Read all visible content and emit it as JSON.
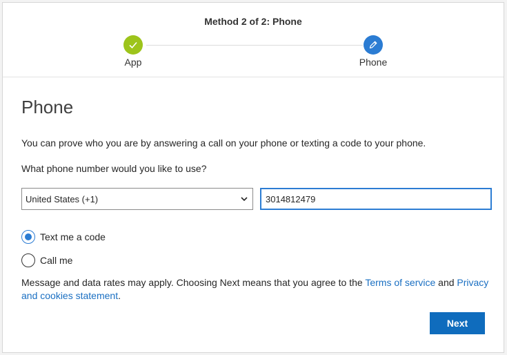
{
  "header": {
    "step_title": "Method 2 of 2: Phone",
    "steps": [
      {
        "label": "App",
        "state": "completed",
        "icon": "checkmark-icon",
        "color": "#9dc41b"
      },
      {
        "label": "Phone",
        "state": "current",
        "icon": "pencil-icon",
        "color": "#2b7cd3"
      }
    ]
  },
  "main": {
    "title": "Phone",
    "description": "You can prove who you are by answering a call on your phone or texting a code to your phone.",
    "question": "What phone number would you like to use?",
    "country_select": {
      "value": "United States (+1)"
    },
    "phone_input": {
      "value": "3014812479"
    },
    "options": [
      {
        "label": "Text me a code",
        "selected": true
      },
      {
        "label": "Call me",
        "selected": false
      }
    ],
    "disclaimer": {
      "prefix": "Message and data rates may apply. Choosing Next means that you agree to the ",
      "terms_link": "Terms of service",
      "middle": " and ",
      "privacy_link": "Privacy and cookies statement",
      "suffix": "."
    },
    "next_label": "Next"
  },
  "colors": {
    "accent": "#2b7cd3",
    "success": "#9dc41b",
    "button": "#0f6cbd",
    "link": "#1a6fc2"
  }
}
